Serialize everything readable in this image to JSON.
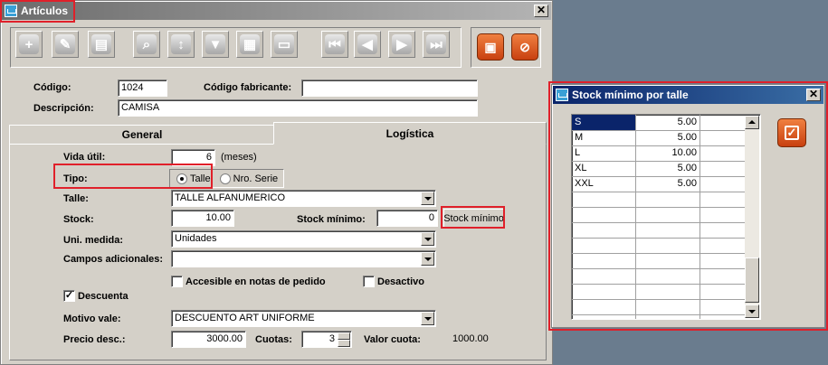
{
  "main_window": {
    "title": "Artículos",
    "close_glyph": "✕",
    "toolbar": {
      "buttons": [
        "plus-icon",
        "pencil-icon",
        "delete-doc-icon",
        "search-icon",
        "sort-icon",
        "filter-icon",
        "report-icon",
        "print-icon",
        "first-icon",
        "prev-icon",
        "next-icon",
        "last-icon"
      ],
      "save_icon": "save-icon",
      "cancel_icon": "cancel-icon"
    },
    "codigo_label": "Código:",
    "codigo_value": "1024",
    "codigo_fab_label": "Código fabricante:",
    "codigo_fab_value": "",
    "descripcion_label": "Descripción:",
    "descripcion_value": "CAMISA",
    "tabs": [
      {
        "label": "General",
        "active": false
      },
      {
        "label": "Logística",
        "active": true
      }
    ],
    "vida_util_label": "Vida útil:",
    "vida_util_value": "6",
    "vida_util_unit": "(meses)",
    "tipo_label": "Tipo:",
    "tipo_options": [
      {
        "label": "Talle",
        "selected": true
      },
      {
        "label": "Nro. Serie",
        "selected": false
      }
    ],
    "talle_label": "Talle:",
    "talle_value": "TALLE ALFANUMERICO",
    "stock_label": "Stock:",
    "stock_value": "10.00",
    "stock_min_label": "Stock mínimo:",
    "stock_min_value": "0",
    "stock_min_button": "Stock mínimo",
    "uni_medida_label": "Uni. medida:",
    "uni_medida_value": "Unidades",
    "campos_label": "Campos adicionales:",
    "campos_value": "",
    "accesible_label": "Accesible en notas de pedido",
    "accesible_checked": false,
    "desactivo_label": "Desactivo",
    "desactivo_checked": false,
    "descuenta_label": "Descuenta",
    "descuenta_checked": true,
    "check_glyph": "✓",
    "motivo_label": "Motivo vale:",
    "motivo_value": "DESCUENTO ART UNIFORME",
    "precio_label": "Precio desc.:",
    "precio_value": "3000.00",
    "cuotas_label": "Cuotas:",
    "cuotas_value": "3",
    "valor_cuota_label": "Valor cuota:",
    "valor_cuota_value": "1000.00"
  },
  "stock_window": {
    "title": "Stock mínimo por talle",
    "close_glyph": "✕",
    "rows": [
      {
        "talle": "S",
        "value": "5.00"
      },
      {
        "talle": "M",
        "value": "5.00"
      },
      {
        "talle": "L",
        "value": "10.00"
      },
      {
        "talle": "XL",
        "value": "5.00"
      },
      {
        "talle": "XXL",
        "value": "5.00"
      }
    ],
    "confirm_icon": "checkbox-confirm-icon",
    "confirm_glyph": "✓"
  },
  "colors": {
    "title_active": "#0a246a",
    "title_inactive": "#808080",
    "highlight": "#e0202a",
    "selection": "#0a246a",
    "orange": "#e06020"
  }
}
